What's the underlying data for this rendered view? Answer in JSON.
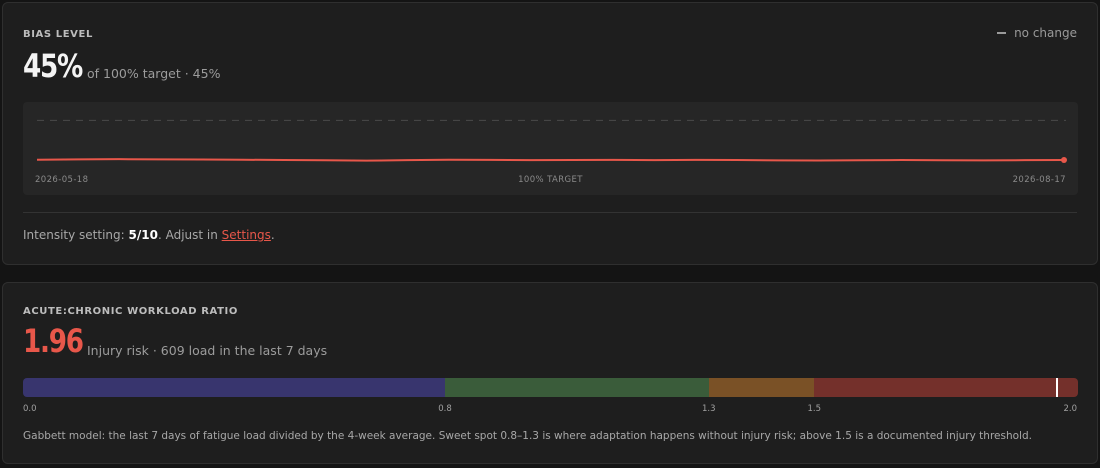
{
  "bias": {
    "label": "BIAS LEVEL",
    "value": "45%",
    "subtext": "of 100% target · 45%",
    "change_label": "no change",
    "chart_data": {
      "type": "line",
      "x_start": "2026-05-18",
      "x_end": "2026-08-17",
      "target_label": "100% TARGET",
      "target": 100,
      "ylim": [
        0,
        120
      ],
      "series": [
        {
          "values": [
            45,
            45.5,
            45.8,
            45.6,
            45.3,
            45.0,
            44.7,
            44.3,
            43.8,
            44.4,
            45.0,
            44.8,
            44.5,
            44.6,
            44.9,
            44.4,
            44.8,
            44.6,
            44.1,
            44.0,
            44.3,
            44.6,
            44.3,
            44.2,
            44.4,
            44.6
          ]
        }
      ],
      "line_color": "#e8574a",
      "target_color": "#4a4a4a"
    },
    "intensity": {
      "prefix": "Intensity setting: ",
      "value": "5/10",
      "middle": ". Adjust in ",
      "link": "Settings",
      "suffix": "."
    }
  },
  "acwr": {
    "label": "ACUTE:CHRONIC WORKLOAD RATIO",
    "value": "1.96",
    "subtext": "Injury risk · 609 load in the last 7 days",
    "ratio": 1.96,
    "scale_max": 2.0,
    "zones": [
      {
        "from": 0.0,
        "to": 0.8,
        "color": "#38356e"
      },
      {
        "from": 0.8,
        "to": 1.3,
        "color": "#3a5c3a"
      },
      {
        "from": 1.3,
        "to": 1.5,
        "color": "#7a5126"
      },
      {
        "from": 1.5,
        "to": 2.0,
        "color": "#74302b"
      }
    ],
    "ticks": [
      "0.0",
      "0.8",
      "1.3",
      "1.5",
      "2.0"
    ],
    "note": "Gabbett model: the last 7 days of fatigue load divided by the 4-week average. Sweet spot 0.8–1.3 is where adaptation happens without injury risk; above 1.5 is a documented injury threshold.",
    "accent": "#e8574a"
  }
}
